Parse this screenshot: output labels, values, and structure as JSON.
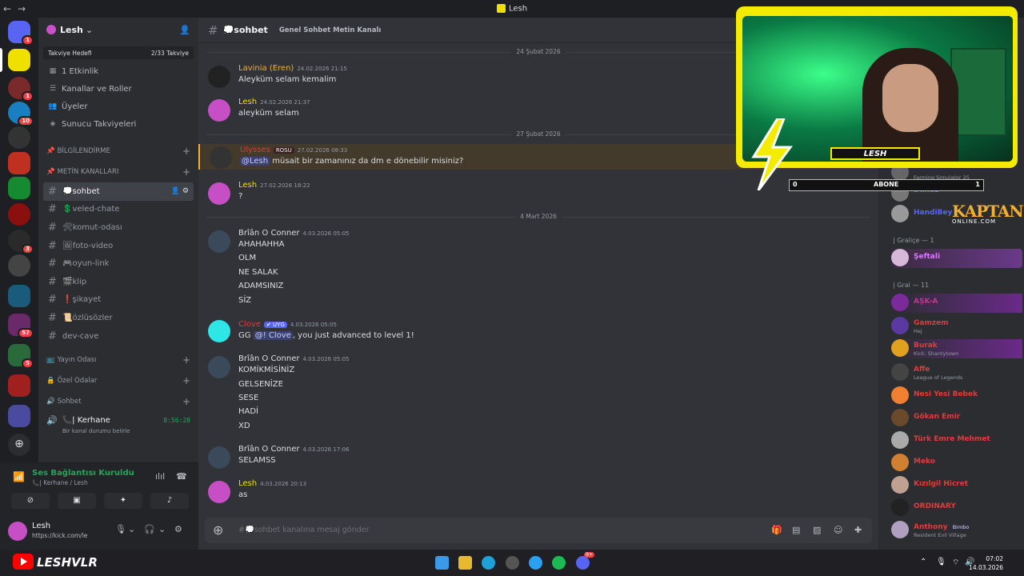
{
  "titlebar": {
    "back": "←",
    "forward": "→",
    "title": "Lesh"
  },
  "rail": {
    "badges": [
      "1",
      "1",
      "10",
      "3",
      "57",
      "5"
    ]
  },
  "guild": {
    "name": "Lesh",
    "boost_label": "Takviye Hedefi",
    "boost_progress": "2/33 Takviye",
    "events": "1 Etkinlik",
    "channels_roles": "Kanallar ve Roller",
    "members": "Üyeler",
    "boosts": "Sunucu Takviyeleri"
  },
  "categories": {
    "info": "BİLGİLENDİRME",
    "text": "METİN KANALLARI",
    "stream": "Yayın Odası",
    "private": "Özel Odalar",
    "voice": "Sohbet"
  },
  "channels": [
    {
      "label": "💭sohbet",
      "active": true
    },
    {
      "label": "💲veled-chate"
    },
    {
      "label": "🛠komut-odası"
    },
    {
      "label": "🖼foto-video"
    },
    {
      "label": "🎮oyun-link"
    },
    {
      "label": "🎬klip"
    },
    {
      "label": "❗şikayet"
    },
    {
      "label": "📜özlüsözler"
    },
    {
      "label": "dev-cave"
    }
  ],
  "voice_channel": {
    "user": "📞| Kerhane",
    "timer": "8:56:28",
    "status": "Bir kanal durumu belirle"
  },
  "voice_panel": {
    "connected": "Ses Bağlantısı Kuruldu",
    "location": "📞| Kerhane / Lesh"
  },
  "user_panel": {
    "name": "Lesh",
    "status": "https://kick.com/le"
  },
  "chat": {
    "channel": "💭sohbet",
    "topic": "Genel Sohbet Metin Kanalı",
    "input_placeholder": "#💭sohbet kanalına mesaj gönder",
    "dividers": [
      "24 Şubat 2026",
      "27 Şubat 2026",
      "4 Mart 2026"
    ],
    "messages": [
      {
        "author": "Lavinia (Eren)",
        "time": "24.02.2026 21:15",
        "lines": [
          "Aleyküm selam kemalim"
        ]
      },
      {
        "author": "Lesh",
        "time": "24.02.2026 21:37",
        "lines": [
          "aleyküm selam"
        ]
      },
      {
        "author": "Ulysses",
        "tag": "ROSU",
        "time": "27.02.2026 08:33",
        "mention": "@Lesh",
        "lines": [
          "müsait bir zamanınız da dm e dönebilir misiniz?"
        ]
      },
      {
        "author": "Lesh",
        "time": "27.02.2026 18:22",
        "lines": [
          "?"
        ]
      },
      {
        "author": "Brîân O Conner",
        "time": "4.03.2026 05:05",
        "lines": [
          "AHAHAHHA",
          "OLM",
          "NE SALAK",
          "ADAMSINIZ",
          "SİZ"
        ]
      },
      {
        "author": "Clove",
        "tag": "✔ UYG",
        "time": "4.03.2026 05:05",
        "mention": "@! Clove",
        "prefix": "GG",
        "lines": [
          ", you just advanced to level 1!"
        ]
      },
      {
        "author": "Brîân O Conner",
        "time": "4.03.2026 05:05",
        "lines": [
          "KOMİKMİSİNİZ",
          "GELSENİZE",
          "SESE",
          "HADİ",
          "XD"
        ]
      },
      {
        "author": "Brîân O Conner",
        "time": "4.03.2026 17:06",
        "lines": [
          "SELAMSS"
        ]
      },
      {
        "author": "Lesh",
        "time": "4.03.2026 20:13",
        "lines": [
          "as"
        ]
      }
    ]
  },
  "members": {
    "roles": [
      "| Graliçe — 1",
      "| Gral — 11"
    ],
    "list": [
      {
        "name": "",
        "activity": "Farming Simulator 25",
        "color": "#949ba4"
      },
      {
        "name": "Dilnaz",
        "activity": "",
        "color": "#5865f2"
      },
      {
        "name": "HandiBey",
        "activity": "",
        "color": "#5865f2"
      },
      {
        "name": "Şeftali",
        "activity": "",
        "color": "#e078ff"
      },
      {
        "name": "AŞK-A",
        "activity": "",
        "color": "#c0398f"
      },
      {
        "name": "Gamzem",
        "activity": "Hej",
        "color": "#e03c3c"
      },
      {
        "name": "Burak",
        "activity": "Kick: Shantytown",
        "color": "#e03c3c"
      },
      {
        "name": "Affe",
        "activity": "League of Legends",
        "color": "#e03c3c"
      },
      {
        "name": "Nesi Yesi Bebek",
        "activity": "",
        "color": "#e03c3c"
      },
      {
        "name": "Gökan Emir",
        "activity": "",
        "color": "#e03c3c"
      },
      {
        "name": "Türk Emre Mehmet",
        "activity": "",
        "color": "#e03c3c"
      },
      {
        "name": "Meko",
        "activity": "",
        "color": "#e03c3c"
      },
      {
        "name": "Kızılgil Hicret",
        "activity": "",
        "color": "#e03c3c"
      },
      {
        "name": "ORDINARY",
        "activity": "",
        "color": "#e03c3c"
      },
      {
        "name": "Anthony",
        "tag": "Bimbo",
        "activity": "Resident Evil Village",
        "color": "#e03c3c"
      }
    ]
  },
  "overlay": {
    "streamer": "LESH",
    "sub_left": "0",
    "sub_label": "ABONE",
    "sub_right": "1",
    "brand_big": "KAPTAN",
    "brand_small": "ONLINE.COM"
  },
  "taskbar": {
    "brand": "LESHVLR",
    "time": "07:02",
    "date": "14.03.2026",
    "badge": "9+"
  }
}
